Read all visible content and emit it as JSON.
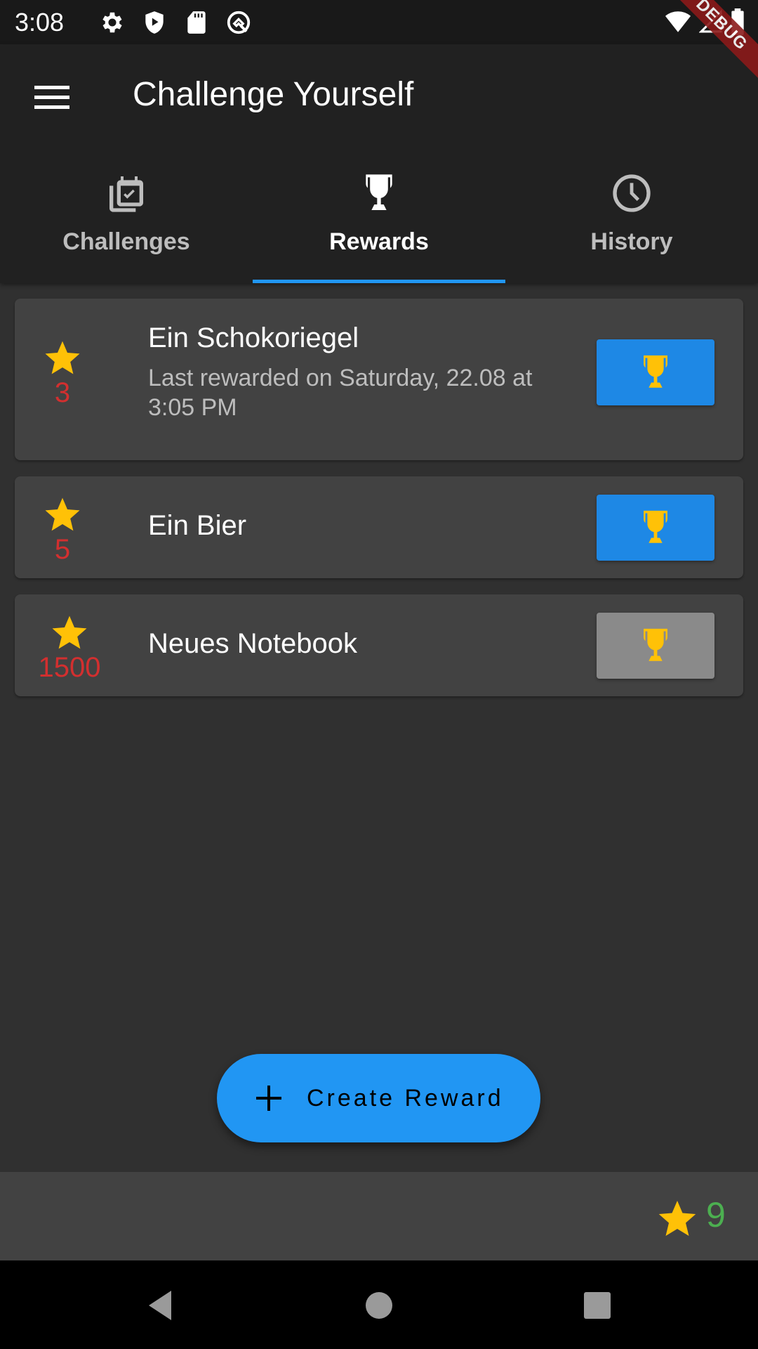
{
  "status_bar": {
    "time": "3:08",
    "left_icons": [
      "gear-icon",
      "shield-play-icon",
      "sd-card-icon",
      "q-logo-icon"
    ],
    "right_icons": [
      "wifi-icon",
      "signal-icon",
      "battery-icon"
    ]
  },
  "debug_banner": "DEBUG",
  "app_bar": {
    "title": "Challenge Yourself",
    "menu_icon": "hamburger-menu-icon"
  },
  "tabs": [
    {
      "label": "Challenges",
      "icon": "calendar-check-icon",
      "active": false
    },
    {
      "label": "Rewards",
      "icon": "trophy-icon",
      "active": true
    },
    {
      "label": "History",
      "icon": "clock-icon",
      "active": false
    }
  ],
  "rewards": [
    {
      "name": "Ein Schokoriegel",
      "cost": "3",
      "subtitle": "Last rewarded on Saturday, 22.08 at 3:05 PM",
      "claimable": true
    },
    {
      "name": "Ein Bier",
      "cost": "5",
      "subtitle": "",
      "claimable": true
    },
    {
      "name": "Neues Notebook",
      "cost": "1500",
      "subtitle": "",
      "claimable": false
    }
  ],
  "fab": {
    "label": "Create Reward",
    "icon": "plus-icon"
  },
  "points": {
    "value": "9",
    "icon": "star-icon"
  },
  "nav_bar": [
    "back-icon",
    "home-icon",
    "recents-icon"
  ],
  "colors": {
    "accent": "#2196f3",
    "claim_enabled": "#1e88e5",
    "claim_disabled": "#8a8a8a",
    "star": "#ffc107",
    "cost_text": "#d32f2f",
    "points_text": "#4caf50",
    "card": "#424242",
    "app_bar": "#212121",
    "background": "#303030"
  }
}
